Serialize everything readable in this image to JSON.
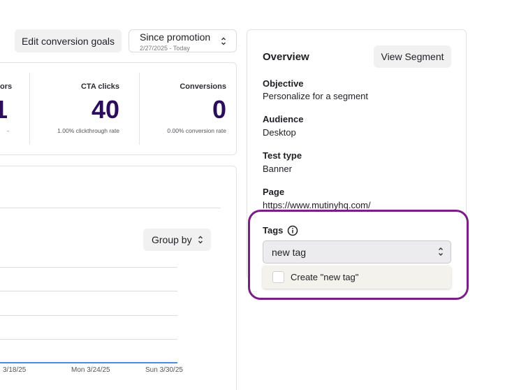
{
  "toolbar": {
    "edit_goals_label": "Edit conversion goals",
    "date_range": {
      "label": "Since promotion",
      "sub": "2/27/2025 - Today"
    }
  },
  "metrics": [
    {
      "label": "ors",
      "value": "1",
      "sub": "-"
    },
    {
      "label": "CTA clicks",
      "value": "40",
      "sub": "1.00% clickthrough rate"
    },
    {
      "label": "Conversions",
      "value": "0",
      "sub": "0.00% conversion rate"
    }
  ],
  "chart": {
    "group_by_label": "Group by",
    "x_ticks": [
      "3/18/25",
      "Mon 3/24/25",
      "Sun 3/30/25"
    ],
    "line_color": "#4a90d9"
  },
  "overview": {
    "title": "Overview",
    "view_segment_label": "View Segment",
    "fields": [
      {
        "label": "Objective",
        "value": "Personalize for a segment"
      },
      {
        "label": "Audience",
        "value": "Desktop"
      },
      {
        "label": "Test type",
        "value": "Banner"
      },
      {
        "label": "Page",
        "value": "https://www.mutinyhq.com/"
      }
    ],
    "tags": {
      "label": "Tags",
      "info_icon": "info-icon",
      "input_value": "new tag",
      "create_option": "Create \"new tag\""
    }
  },
  "colors": {
    "accent": "#2b0d5c",
    "highlight": "#7a1f86"
  }
}
